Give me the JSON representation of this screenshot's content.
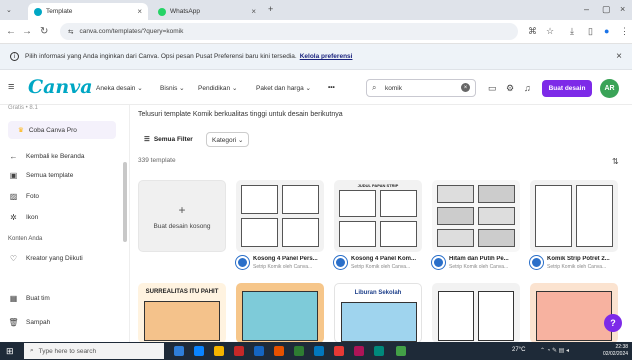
{
  "browser": {
    "tabs": [
      {
        "title": "Template",
        "active": true
      },
      {
        "title": "WhatsApp",
        "active": false
      }
    ],
    "new_tab": "+",
    "url": "canva.com/templates/?query=komik"
  },
  "banner": {
    "text": "Pilih informasi yang Anda inginkan dari Canva. Opsi pesan Pusat Preferensi baru kini tersedia.",
    "link": "Kelola preferensi"
  },
  "header": {
    "logo": "Canva",
    "nav": [
      "Aneka desain ⌄",
      "Bisnis ⌄",
      "Pendidikan ⌄",
      "Paket dan harga ⌄",
      "•••"
    ],
    "search_value": "komik",
    "create_button": "Buat desain",
    "avatar_initials": "AR"
  },
  "sidebar": {
    "top_faded": "Gratis • 8.1",
    "pro_button": "Coba Canva Pro",
    "items": [
      {
        "label": "Kembali ke Beranda",
        "icon": "arrow-left-icon"
      },
      {
        "label": "Semua template",
        "icon": "template-icon"
      },
      {
        "label": "Foto",
        "icon": "photo-icon"
      },
      {
        "label": "Ikon",
        "icon": "shapes-icon"
      }
    ],
    "section_label": "Konten Anda",
    "section_items": [
      {
        "label": "Kreator yang Diikuti",
        "icon": "heart-icon"
      },
      {
        "label": "Buat tim",
        "icon": "team-icon"
      },
      {
        "label": "Sampah",
        "icon": "trash-icon"
      }
    ]
  },
  "main": {
    "intro": "Telusuri template Komik berkualitas tinggi untuk desain berikutnya",
    "filter_button": "Semua Filter",
    "category_button": "Kategori ⌄",
    "count": "339 template",
    "blank_card": {
      "label": "Buat desain kosong",
      "plus": "+"
    },
    "templates": [
      {
        "title": "Kosong 4 Panel Pers...",
        "subtitle": "Setrip Komik oleh Canva..."
      },
      {
        "title": "Kosong 4 Panel Kom...",
        "subtitle": "Setrip Komik oleh Canva..."
      },
      {
        "title": "Hitam dan Putih Pe...",
        "subtitle": "Setrip Komik oleh Canva..."
      },
      {
        "title": "Komik Strip Potret 2...",
        "subtitle": "Setrip Komik oleh Canva..."
      }
    ],
    "thumb_text": {
      "card2": "JUDUL PAPAN STRIP"
    },
    "row2_titles": [
      "SURREALITAS ITU PAHIT",
      "",
      "Liburan Sekolah",
      "",
      ""
    ]
  },
  "taskbar": {
    "search_placeholder": "Type here to search",
    "weather": "27°C",
    "time": "22:38",
    "date": "02/02/2024"
  },
  "colors": {
    "canva_teal": "#00a7c4",
    "canva_purple": "#7d2ae8",
    "avatar_green": "#3aa357"
  }
}
